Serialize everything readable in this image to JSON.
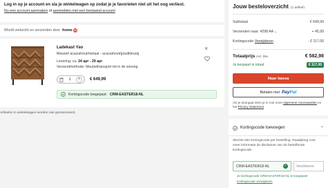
{
  "notice": {
    "title": "Log in op je account en sla je winkelwagen op zodat je je favorieten niet uit het oog verliest.",
    "link_login": "Nu een account aanmaken",
    "link_or": "of",
    "link_existing": "aanmelden met een bestaand account"
  },
  "seller": {
    "text": "Wordt verkocht en verzonden door",
    "brand": "home",
    "brand_num": "24"
  },
  "product": {
    "name": "Ladekast Yao",
    "material": "Massief acaciahout/metaal - acaciahout/goudkleurig",
    "delivery_label": "Levering: ca.",
    "delivery_dates": "24 apr - 29 apr",
    "shipping": "Verzendmethode: Meubeltransport tot in de woning",
    "quantity": "1",
    "price": "€ 649,99",
    "coupon_label": "Kortingscode toegepast:",
    "coupon_code": "CRM-EASTER18-NL"
  },
  "cart_notice": "Artikelen in winkelwagen worden niet gereserveerd.",
  "summary": {
    "title": "Jouw besteloverzicht",
    "count": "(1 artikel)",
    "subtotal_label": "Subtotaal",
    "subtotal_value": "€ 649,99",
    "shipping_label": "Verzenden naar: 4298 AA",
    "shipping_value": "+ 45,99",
    "discount_label": "Kortingscode",
    "discount_link": "Verwijderen",
    "discount_value": "- € 117,00",
    "total_label": "Totaalprijs",
    "total_tax": "Incl. btw.",
    "total_value": "€ 582,98",
    "saved_label": "Je bespaart in totaal:",
    "saved_value": "€ 117,00",
    "checkout_label": "Naar kassa",
    "paypal_prefix": "Betalen met",
    "paypal_a": "Pay",
    "paypal_b": "Pal",
    "terms_text": "Als je doorgaat stem je in met onze",
    "terms_link1": "Algemene Voorwaarden",
    "terms_and": "en het",
    "terms_link2": "Privacy Statement"
  },
  "coupon": {
    "header": "Kortingscode toevoegen",
    "desc": "Slechts één kortingscode per bestelling. Raadpleeg voor meer informatie de disclaimer van de betreffende kortingscode.",
    "input_value": "CRM-EASTER18-NL",
    "verify_label": "Verzilveren",
    "status": "Je kortingscode CRM-EASTER18-NL is toegepast",
    "remove_link": "Kortingscode verwijderen"
  },
  "colors": {
    "accent": "#d8452b",
    "success": "#2e7d4f",
    "paypal_dark": "#1b3a8c",
    "paypal_light": "#2a9bd8"
  }
}
